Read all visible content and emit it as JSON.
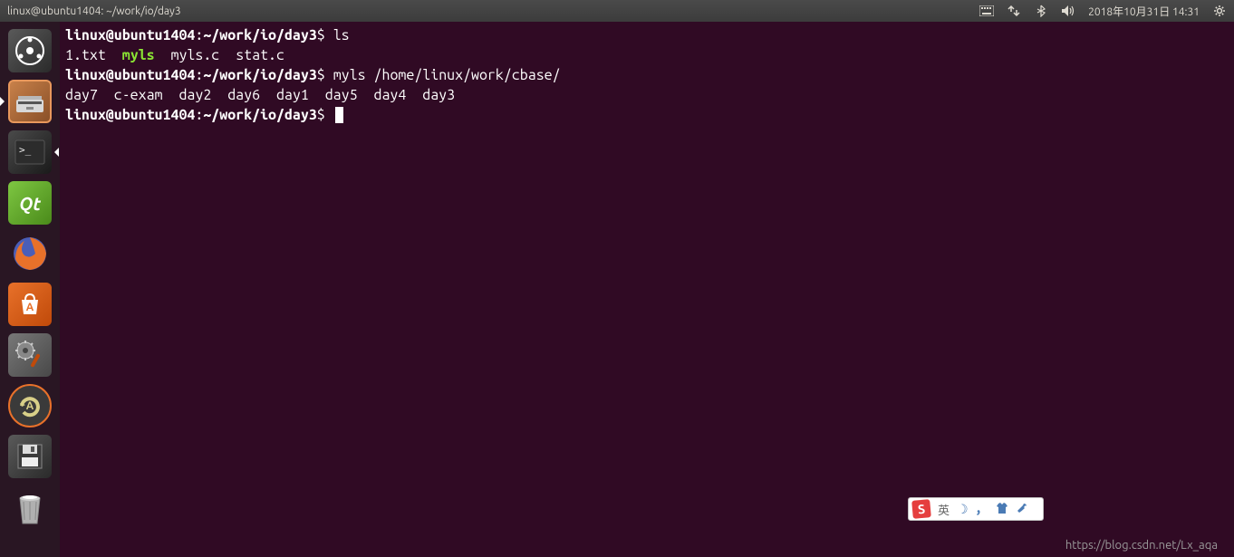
{
  "topbar": {
    "title": "linux@ubuntu1404: ~/work/io/day3",
    "datetime": "2018年10月31日 14:31"
  },
  "launcher": {
    "items": [
      {
        "name": "dash",
        "label": "Dash"
      },
      {
        "name": "files",
        "label": "Files"
      },
      {
        "name": "terminal",
        "label": "Terminal"
      },
      {
        "name": "qt-creator",
        "label": "Qt"
      },
      {
        "name": "firefox",
        "label": "Firefox"
      },
      {
        "name": "software-center",
        "label": "Software Center"
      },
      {
        "name": "settings",
        "label": "Settings"
      },
      {
        "name": "software-updater",
        "label": "Software Updater"
      },
      {
        "name": "save",
        "label": "Save"
      },
      {
        "name": "trash",
        "label": "Trash"
      }
    ]
  },
  "terminal": {
    "prompt_user": "linux@ubuntu1404",
    "prompt_path": "~/work/io/day3",
    "lines": [
      {
        "type": "prompt",
        "cmd": "ls"
      },
      {
        "type": "ls_output",
        "items": [
          {
            "text": "1.txt",
            "cls": ""
          },
          {
            "text": "myls",
            "cls": "exec"
          },
          {
            "text": "myls.c",
            "cls": ""
          },
          {
            "text": "stat.c",
            "cls": ""
          }
        ]
      },
      {
        "type": "prompt",
        "cmd": "myls /home/linux/work/cbase/"
      },
      {
        "type": "plain",
        "text": "day7  c-exam  day2  day6  day1  day5  day4  day3"
      },
      {
        "type": "prompt",
        "cmd": ""
      }
    ]
  },
  "ime": {
    "logo": "S",
    "lang": "英"
  },
  "watermark": "https://blog.csdn.net/Lx_aqa"
}
